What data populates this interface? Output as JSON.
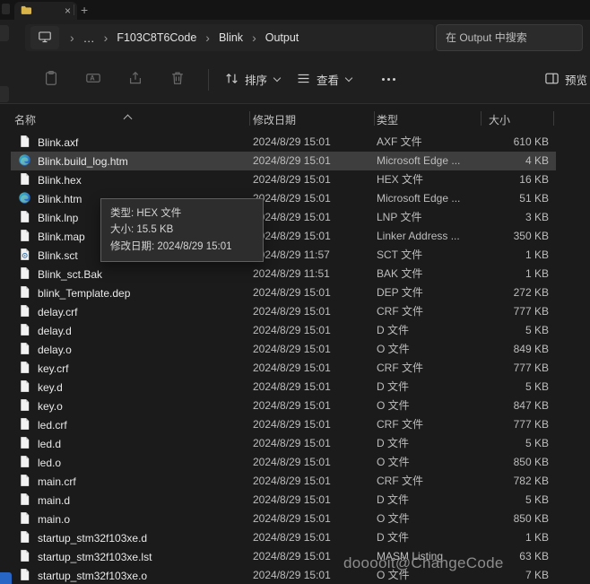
{
  "titlebar": {
    "close_tab": "×",
    "new_tab": "+"
  },
  "breadcrumb": {
    "ellipsis": "…",
    "chevron": "›",
    "segments": [
      "F103C8T6Code",
      "Blink",
      "Output"
    ],
    "search_placeholder": "在 Output 中搜索"
  },
  "toolbar": {
    "sort_label": "排序",
    "view_label": "查看",
    "preview_label": "预览"
  },
  "columns": {
    "name": "名称",
    "date": "修改日期",
    "type": "类型",
    "size": "大小"
  },
  "files": [
    {
      "name": "Blink.axf",
      "date": "2024/8/29 15:01",
      "type": "AXF 文件",
      "size": "610 KB",
      "icon": "doc",
      "selected": false
    },
    {
      "name": "Blink.build_log.htm",
      "date": "2024/8/29 15:01",
      "type": "Microsoft Edge ...",
      "size": "4 KB",
      "icon": "edge",
      "selected": true
    },
    {
      "name": "Blink.hex",
      "date": "2024/8/29 15:01",
      "type": "HEX 文件",
      "size": "16 KB",
      "icon": "doc",
      "selected": false
    },
    {
      "name": "Blink.htm",
      "date": "2024/8/29 15:01",
      "type": "Microsoft Edge ...",
      "size": "51 KB",
      "icon": "edge",
      "selected": false
    },
    {
      "name": "Blink.lnp",
      "date": "2024/8/29 15:01",
      "type": "LNP 文件",
      "size": "3 KB",
      "icon": "doc",
      "selected": false
    },
    {
      "name": "Blink.map",
      "date": "2024/8/29 15:01",
      "type": "Linker Address ...",
      "size": "350 KB",
      "icon": "doc",
      "selected": false
    },
    {
      "name": "Blink.sct",
      "date": "2024/8/29 11:57",
      "type": "SCT 文件",
      "size": "1 KB",
      "icon": "gear",
      "selected": false
    },
    {
      "name": "Blink_sct.Bak",
      "date": "2024/8/29 11:51",
      "type": "BAK 文件",
      "size": "1 KB",
      "icon": "doc",
      "selected": false
    },
    {
      "name": "blink_Template.dep",
      "date": "2024/8/29 15:01",
      "type": "DEP 文件",
      "size": "272 KB",
      "icon": "doc",
      "selected": false
    },
    {
      "name": "delay.crf",
      "date": "2024/8/29 15:01",
      "type": "CRF 文件",
      "size": "777 KB",
      "icon": "doc",
      "selected": false
    },
    {
      "name": "delay.d",
      "date": "2024/8/29 15:01",
      "type": "D 文件",
      "size": "5 KB",
      "icon": "doc",
      "selected": false
    },
    {
      "name": "delay.o",
      "date": "2024/8/29 15:01",
      "type": "O 文件",
      "size": "849 KB",
      "icon": "doc",
      "selected": false
    },
    {
      "name": "key.crf",
      "date": "2024/8/29 15:01",
      "type": "CRF 文件",
      "size": "777 KB",
      "icon": "doc",
      "selected": false
    },
    {
      "name": "key.d",
      "date": "2024/8/29 15:01",
      "type": "D 文件",
      "size": "5 KB",
      "icon": "doc",
      "selected": false
    },
    {
      "name": "key.o",
      "date": "2024/8/29 15:01",
      "type": "O 文件",
      "size": "847 KB",
      "icon": "doc",
      "selected": false
    },
    {
      "name": "led.crf",
      "date": "2024/8/29 15:01",
      "type": "CRF 文件",
      "size": "777 KB",
      "icon": "doc",
      "selected": false
    },
    {
      "name": "led.d",
      "date": "2024/8/29 15:01",
      "type": "D 文件",
      "size": "5 KB",
      "icon": "doc",
      "selected": false
    },
    {
      "name": "led.o",
      "date": "2024/8/29 15:01",
      "type": "O 文件",
      "size": "850 KB",
      "icon": "doc",
      "selected": false
    },
    {
      "name": "main.crf",
      "date": "2024/8/29 15:01",
      "type": "CRF 文件",
      "size": "782 KB",
      "icon": "doc",
      "selected": false
    },
    {
      "name": "main.d",
      "date": "2024/8/29 15:01",
      "type": "D 文件",
      "size": "5 KB",
      "icon": "doc",
      "selected": false
    },
    {
      "name": "main.o",
      "date": "2024/8/29 15:01",
      "type": "O 文件",
      "size": "850 KB",
      "icon": "doc",
      "selected": false
    },
    {
      "name": "startup_stm32f103xe.d",
      "date": "2024/8/29 15:01",
      "type": "D 文件",
      "size": "1 KB",
      "icon": "doc",
      "selected": false
    },
    {
      "name": "startup_stm32f103xe.lst",
      "date": "2024/8/29 15:01",
      "type": "MASM Listing",
      "size": "63 KB",
      "icon": "doc",
      "selected": false
    },
    {
      "name": "startup_stm32f103xe.o",
      "date": "2024/8/29 15:01",
      "type": "O 文件",
      "size": "7 KB",
      "icon": "doc",
      "selected": false
    }
  ],
  "tooltip": {
    "type_line": "类型: HEX 文件",
    "size_line": "大小: 15.5 KB",
    "date_line": "修改日期: 2024/8/29 15:01"
  },
  "watermark": "dooooit@ChangeCode",
  "colors": {
    "selection": "#3e3e3e",
    "edge_accent": "#2e7cd6",
    "background": "#1b1b1b"
  }
}
